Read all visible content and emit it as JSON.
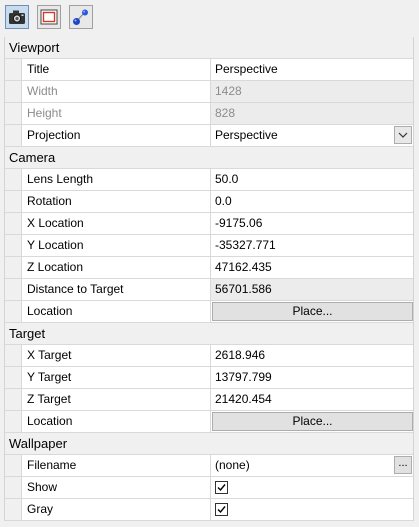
{
  "toolbar": {
    "buttons": [
      {
        "name": "camera-icon",
        "active": true
      },
      {
        "name": "frame-icon",
        "active": false
      },
      {
        "name": "target-icon",
        "active": false
      }
    ]
  },
  "sections": [
    {
      "title": "Viewport",
      "rows": [
        {
          "label": "Title",
          "value": "Perspective",
          "kind": "text"
        },
        {
          "label": "Width",
          "value": "1428",
          "kind": "disabled"
        },
        {
          "label": "Height",
          "value": "828",
          "kind": "disabled"
        },
        {
          "label": "Projection",
          "value": "Perspective",
          "kind": "dropdown"
        }
      ]
    },
    {
      "title": "Camera",
      "rows": [
        {
          "label": "Lens Length",
          "value": "50.0",
          "kind": "text"
        },
        {
          "label": "Rotation",
          "value": "0.0",
          "kind": "text"
        },
        {
          "label": "X Location",
          "value": "-9175.06",
          "kind": "text"
        },
        {
          "label": "Y Location",
          "value": "-35327.771",
          "kind": "text"
        },
        {
          "label": "Z Location",
          "value": "47162.435",
          "kind": "text"
        },
        {
          "label": "Distance to Target",
          "value": "56701.586",
          "kind": "readonly"
        },
        {
          "label": "Location",
          "value": "Place...",
          "kind": "button"
        }
      ]
    },
    {
      "title": "Target",
      "rows": [
        {
          "label": "X Target",
          "value": "2618.946",
          "kind": "text"
        },
        {
          "label": "Y Target",
          "value": "13797.799",
          "kind": "text"
        },
        {
          "label": "Z Target",
          "value": "21420.454",
          "kind": "text"
        },
        {
          "label": "Location",
          "value": "Place...",
          "kind": "button"
        }
      ]
    },
    {
      "title": "Wallpaper",
      "rows": [
        {
          "label": "Filename",
          "value": "(none)",
          "kind": "file",
          "button": "..."
        },
        {
          "label": "Show",
          "value": true,
          "kind": "checkbox"
        },
        {
          "label": "Gray",
          "value": true,
          "kind": "checkbox"
        }
      ]
    }
  ]
}
